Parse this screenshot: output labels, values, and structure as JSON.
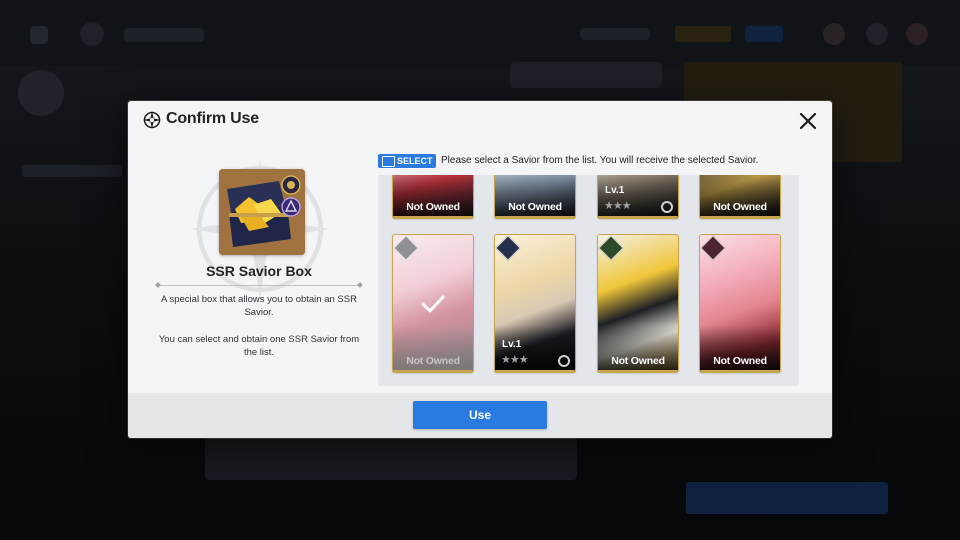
{
  "colors": {
    "accent": "#2a7be0",
    "gold_frame": "#c9a54b",
    "modal_bg": "#f4f5f7",
    "overlay_bg": "#0c0e12"
  },
  "dialog": {
    "title": "Confirm Use",
    "title_icon": "compass-star-icon",
    "close_icon": "close-icon"
  },
  "item": {
    "name": "SSR Savior Box",
    "image": "treasure-chest-icon",
    "description_1": "A special box that allows you to obtain an SSR Savior.",
    "description_2": "You can select and obtain one SSR Savior from the list."
  },
  "selection": {
    "badge": "SELECT",
    "instruction": "Please select a Savior from the list. You will receive the selected Savior."
  },
  "saviors_row_1": [
    {
      "status": "Not Owned",
      "level": "",
      "stars": ""
    },
    {
      "status": "Not Owned",
      "level": "",
      "stars": ""
    },
    {
      "status": "",
      "level": "Lv.1",
      "stars": "★★★"
    },
    {
      "status": "Not Owned",
      "level": "",
      "stars": ""
    }
  ],
  "saviors_row_2": [
    {
      "status": "Not Owned",
      "level": "",
      "stars": "",
      "selected": true
    },
    {
      "status": "",
      "level": "Lv.1",
      "stars": "★★★",
      "selected": false
    },
    {
      "status": "Not Owned",
      "level": "",
      "stars": "",
      "selected": false
    },
    {
      "status": "Not Owned",
      "level": "",
      "stars": "",
      "selected": false
    }
  ],
  "footer": {
    "use_label": "Use"
  }
}
